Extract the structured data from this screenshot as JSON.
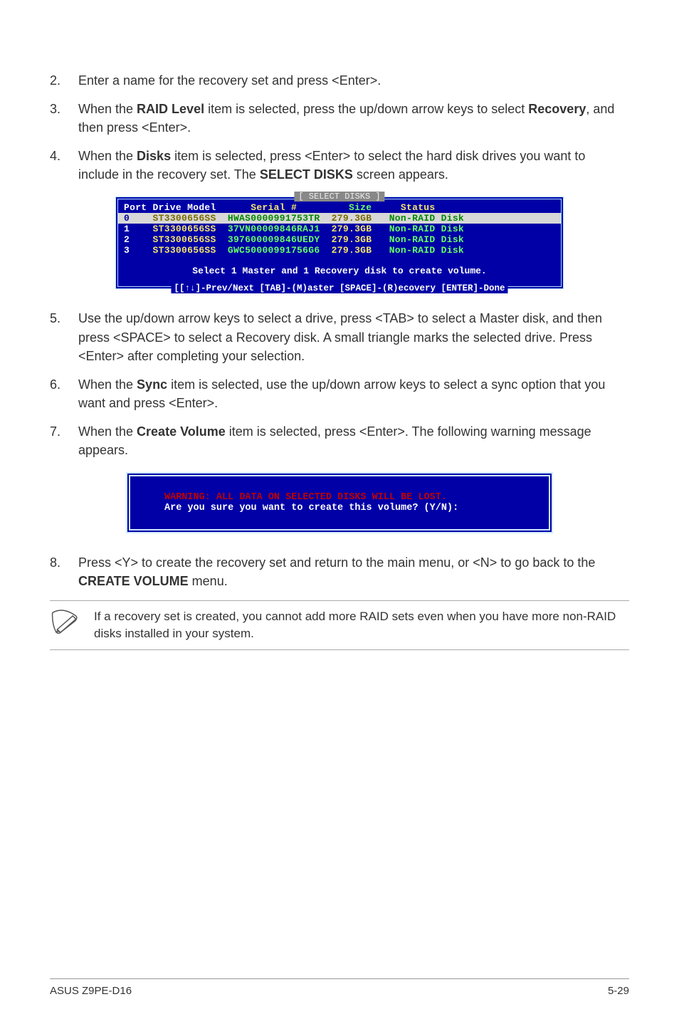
{
  "steps": {
    "s2": {
      "num": "2.",
      "text_a": "Enter a name for the recovery set and press <Enter>."
    },
    "s3": {
      "num": "3.",
      "text_a": "When the ",
      "b1": "RAID Level",
      "text_b": " item is selected, press the up/down arrow keys to select ",
      "b2": "Recovery",
      "text_c": ", and then press <Enter>."
    },
    "s4": {
      "num": "4.",
      "text_a": "When the ",
      "b1": "Disks",
      "text_b": " item is selected, press <Enter> to select the hard disk drives you want to include in the recovery set. The ",
      "b2": "SELECT DISKS",
      "text_c": " screen appears."
    },
    "s5": {
      "num": "5.",
      "text_a": "Use the up/down arrow keys to select a drive, press <TAB> to select a Master disk, and then press <SPACE> to select a Recovery disk. A small triangle marks the selected drive. Press <Enter> after completing your selection."
    },
    "s6": {
      "num": "6.",
      "text_a": "When the ",
      "b1": "Sync",
      "text_b": " item is selected, use the up/down arrow keys to select a sync option that you want and press <Enter>."
    },
    "s7": {
      "num": "7.",
      "text_a": "When the ",
      "b1": "Create Volume",
      "text_b": " item is selected, press <Enter>. The following warning message appears."
    },
    "s8": {
      "num": "8.",
      "text_a": "Press <Y> to create the recovery set and return to the main menu, or <N> to go back to the ",
      "b1": "CREATE VOLUME",
      "text_b": " menu."
    }
  },
  "bios": {
    "title": "[ SELECT DISKS ]",
    "header": "Port Drive Model      Serial #          Size      Status",
    "row0": {
      "port": "0",
      "model": "ST3300656SS",
      "serial": "HWAS0000991753TR",
      "size": "279.3GB",
      "status": "Non-RAID Disk"
    },
    "row1": {
      "port": "1",
      "model": "ST3300656SS",
      "serial": "37VN00009846RAJ1",
      "size": "279.3GB",
      "status": "Non-RAID Disk"
    },
    "row2": {
      "port": "2",
      "model": "ST3300656SS",
      "serial": "397600009846UEDY",
      "size": "279.3GB",
      "status": "Non-RAID Disk"
    },
    "row3": {
      "port": "3",
      "model": "ST3300656SS",
      "serial": "GWC50000991756G6",
      "size": "279.3GB",
      "status": "Non-RAID Disk"
    },
    "msg": "Select 1 Master and 1 Recovery disk to create volume.",
    "footer": "[[↑↓]-Prev/Next [TAB]-(M)aster [SPACE]-(R)ecovery [ENTER]-Done"
  },
  "warn": {
    "danger": "WARNING: ALL DATA ON SELECTED DISKS WILL BE LOST.",
    "prompt": "Are you sure you want to create this volume? (Y/N):"
  },
  "note": {
    "text": "If a recovery set is created, you cannot add more RAID sets even when you have more non-RAID disks installed in your system."
  },
  "footer": {
    "left": "ASUS Z9PE-D16",
    "right": "5-29"
  }
}
